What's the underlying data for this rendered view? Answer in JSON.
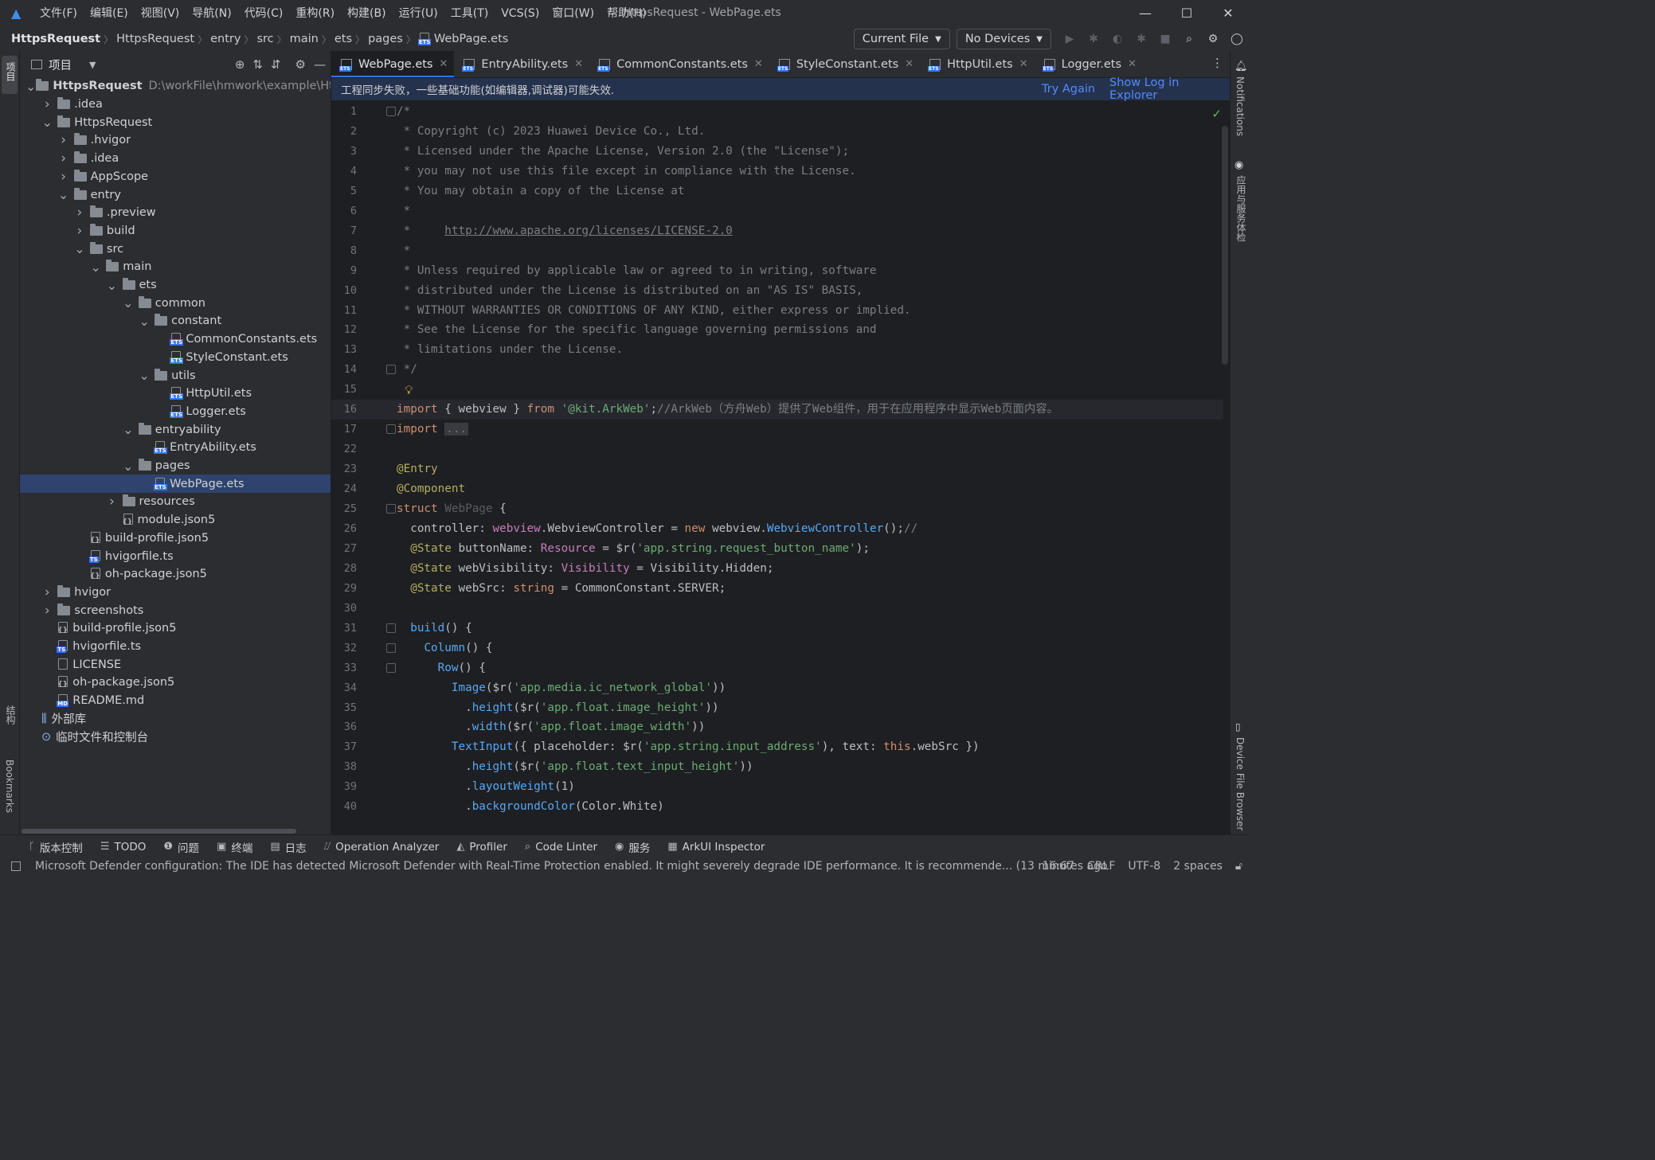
{
  "window": {
    "title": "HttpsRequest - WebPage.ets"
  },
  "menu": [
    "文件(F)",
    "编辑(E)",
    "视图(V)",
    "导航(N)",
    "代码(C)",
    "重构(R)",
    "构建(B)",
    "运行(U)",
    "工具(T)",
    "VCS(S)",
    "窗口(W)",
    "帮助(H)"
  ],
  "breadcrumb": [
    "HttpsRequest",
    "HttpsRequest",
    "entry",
    "src",
    "main",
    "ets",
    "pages",
    "WebPage.ets"
  ],
  "nav": {
    "run_config": "Current File",
    "device": "No Devices"
  },
  "left_rail": {
    "project": "项目",
    "structure": "结构",
    "bookmarks": "Bookmarks"
  },
  "right_rail": {
    "notifications": "Notifications",
    "app_services": "应用与服务体检",
    "device_file_browser": "Device File Browser"
  },
  "project": {
    "title": "项目",
    "root_label": "HttpsRequest",
    "root_path": "D:\\workFile\\hmwork\\example\\HttpsR",
    "items": [
      "HttpsRequest",
      ".idea",
      "HttpsRequest",
      ".hvigor",
      ".idea",
      "AppScope",
      "entry",
      ".preview",
      "build",
      "src",
      "main",
      "ets",
      "common",
      "constant",
      "CommonConstants.ets",
      "StyleConstant.ets",
      "utils",
      "HttpUtil.ets",
      "Logger.ets",
      "entryability",
      "EntryAbility.ets",
      "pages",
      "WebPage.ets",
      "resources",
      "module.json5",
      "build-profile.json5",
      "hvigorfile.ts",
      "oh-package.json5",
      "hvigor",
      "screenshots",
      "build-profile.json5",
      "hvigorfile.ts",
      "LICENSE",
      "oh-package.json5",
      "README.md",
      "外部库",
      "临时文件和控制台"
    ],
    "selected": "WebPage.ets"
  },
  "tabs": [
    "WebPage.ets",
    "EntryAbility.ets",
    "CommonConstants.ets",
    "StyleConstant.ets",
    "HttpUtil.ets",
    "Logger.ets"
  ],
  "banner": {
    "message": "工程同步失败，一些基础功能(如编辑器,调试器)可能失效.",
    "try_again": "Try Again",
    "show_log": "Show Log in Explorer"
  },
  "code": {
    "line_numbers": [
      "1",
      "2",
      "3",
      "4",
      "5",
      "6",
      "7",
      "8",
      "9",
      "10",
      "11",
      "12",
      "13",
      "14",
      "15",
      "16",
      "17",
      "22",
      "23",
      "24",
      "25",
      "26",
      "27",
      "28",
      "29",
      "30",
      "31",
      "32",
      "33",
      "34",
      "35",
      "36",
      "37",
      "38",
      "39",
      "40"
    ],
    "lines": [
      "/*",
      " * Copyright (c) 2023 Huawei Device Co., Ltd.",
      " * Licensed under the Apache License, Version 2.0 (the \"License\");",
      " * you may not use this file except in compliance with the License.",
      " * You may obtain a copy of the License at",
      " *",
      " *     http://www.apache.org/licenses/LICENSE-2.0",
      " *",
      " * Unless required by applicable law or agreed to in writing, software",
      " * distributed under the License is distributed on an \"AS IS\" BASIS,",
      " * WITHOUT WARRANTIES OR CONDITIONS OF ANY KIND, either express or implied.",
      " * See the License for the specific language governing permissions and",
      " * limitations under the License.",
      " */",
      "",
      "import { webview } from '@kit.ArkWeb';//ArkWeb（方舟Web）提供了Web组件，用于在应用程序中显示Web页面内容。",
      "import ...",
      "",
      "@Entry",
      "@Component",
      "struct WebPage {",
      "  controller: webview.WebviewController = new webview.WebviewController();//",
      "  @State buttonName: Resource = $r('app.string.request_button_name');",
      "  @State webVisibility: Visibility = Visibility.Hidden;",
      "  @State webSrc: string = CommonConstant.SERVER;",
      "",
      "  build() {",
      "    Column() {",
      "      Row() {",
      "        Image($r('app.media.ic_network_global'))",
      "          .height($r('app.float.image_height'))",
      "          .width($r('app.float.image_width'))",
      "        TextInput({ placeholder: $r('app.string.input_address'), text: this.webSrc })",
      "          .height($r('app.float.text_input_height'))",
      "          .layoutWeight(1)",
      "          .backgroundColor(Color.White)"
    ]
  },
  "toolwindows": [
    "版本控制",
    "TODO",
    "问题",
    "终端",
    "日志",
    "Operation Analyzer",
    "Profiler",
    "Code Linter",
    "服务",
    "ArkUI Inspector"
  ],
  "status": {
    "message": "Microsoft Defender configuration: The IDE has detected Microsoft Defender with Real-Time Protection enabled. It might severely degrade IDE performance. It is recommende... (13 minutes ago",
    "position": "16:67",
    "line_sep": "CRLF",
    "encoding": "UTF-8",
    "indent": "2 spaces"
  },
  "colors": {
    "accent": "#3574f0",
    "selection": "#2e436e",
    "banner_bg": "#25324d",
    "editor_bg": "#1e1f22",
    "panel_bg": "#2b2d30"
  }
}
